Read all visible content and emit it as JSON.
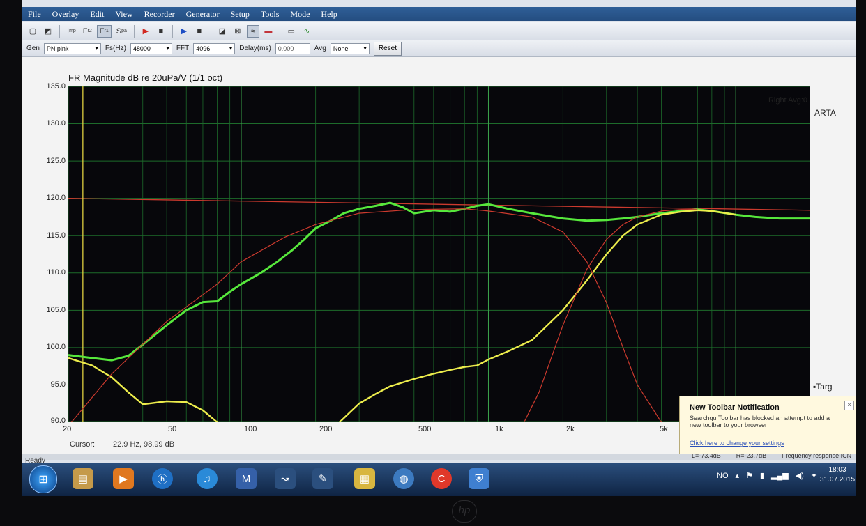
{
  "menu": [
    "File",
    "Overlay",
    "Edit",
    "View",
    "Recorder",
    "Generator",
    "Setup",
    "Tools",
    "Mode",
    "Help"
  ],
  "toolbar1": {
    "buttons": [
      "I",
      "F",
      "F",
      "S"
    ],
    "subs": [
      "mp",
      "r2",
      "r1",
      "pa"
    ]
  },
  "toolbar2": {
    "gen_label": "Gen",
    "gen_value": "PN pink",
    "fs_label": "Fs(Hz)",
    "fs_value": "48000",
    "fft_label": "FFT",
    "fft_value": "4096",
    "delay_label": "Delay(ms)",
    "delay_value": "0.000",
    "avg_label": "Avg",
    "avg_value": "None",
    "reset_label": "Reset"
  },
  "plot": {
    "title": "FR Magnitude dB re 20uPa/V (1/1 oct)",
    "status": "Right  Avg:0",
    "side_label": "ARTA",
    "target_label": "▪Targ",
    "cursor_label": "Cursor:",
    "cursor_value": "22.9 Hz, 98.99 dB",
    "y_ticks": [
      "135.0",
      "130.0",
      "125.0",
      "120.0",
      "115.0",
      "110.0",
      "105.0",
      "100.0",
      "95.0",
      "90.0"
    ],
    "x_ticks": [
      "20",
      "50",
      "100",
      "200",
      "500",
      "1k",
      "2k",
      "5k"
    ]
  },
  "chart_data": {
    "type": "line",
    "title": "FR Magnitude dB re 20uPa/V (1/1 oct)",
    "xlabel": "",
    "ylabel": "",
    "xscale": "log",
    "xlim": [
      20,
      20000
    ],
    "ylim": [
      90,
      135
    ],
    "grid": true,
    "cursor_x": 22.9,
    "colors": {
      "main": "#57e83c",
      "yellow": "#ecec4c",
      "target": "#cc3a2e",
      "cursor": "#e0d040",
      "grid": "#1d6b2b"
    },
    "series": [
      {
        "x": [
          20,
          25,
          30,
          35,
          40,
          50,
          60,
          70,
          80,
          90,
          100,
          120,
          140,
          160,
          180,
          200,
          230,
          260,
          300,
          350,
          400,
          450,
          500,
          600,
          700,
          800,
          900,
          1000,
          1200,
          1500,
          2000,
          2500,
          3000,
          3500,
          4000,
          5000,
          6000,
          7000,
          8000,
          10000,
          12000,
          15000,
          20000
        ],
        "y": [
          99.0,
          98.6,
          98.3,
          98.9,
          100.4,
          103.0,
          105.0,
          106.1,
          106.2,
          107.5,
          108.5,
          110.0,
          111.5,
          113.0,
          114.5,
          116.0,
          117.0,
          118.0,
          118.6,
          119.0,
          119.4,
          118.8,
          118.0,
          118.4,
          118.2,
          118.6,
          119.0,
          119.2,
          118.6,
          118.0,
          117.3,
          117.0,
          117.1,
          117.3,
          117.5,
          118.0,
          118.3,
          118.5,
          118.3,
          117.8,
          117.5,
          117.3,
          117.3
        ]
      },
      {
        "x": [
          20,
          25,
          30,
          35,
          40,
          50,
          60,
          70,
          80
        ],
        "y": [
          98.6,
          97.6,
          96.0,
          94.0,
          92.4,
          92.8,
          92.7,
          91.6,
          90.0
        ]
      },
      {
        "x": [
          250,
          300,
          350,
          400,
          500,
          600,
          700,
          800,
          900,
          1000,
          1200,
          1500,
          2000,
          2500,
          3000,
          3500,
          4000,
          5000,
          6000,
          7000,
          8000,
          10000
        ],
        "y": [
          90.0,
          92.5,
          93.8,
          94.8,
          95.8,
          96.5,
          97.0,
          97.4,
          97.6,
          98.4,
          99.5,
          101.0,
          105.0,
          109.0,
          112.5,
          115.0,
          116.5,
          117.8,
          118.2,
          118.4,
          118.3,
          117.8
        ]
      },
      {
        "x": [
          20,
          30,
          50,
          80,
          100,
          150,
          200,
          300,
          500,
          800,
          1000,
          1500,
          2000,
          2500,
          3000,
          3500,
          4000,
          5000,
          6000,
          7000
        ],
        "y": [
          89.5,
          96.5,
          103.5,
          108.5,
          111.5,
          114.8,
          116.5,
          118.0,
          118.5,
          118.6,
          118.3,
          117.5,
          115.5,
          111.5,
          106.0,
          100.0,
          95.0,
          90.0,
          86.0,
          83.0
        ]
      },
      {
        "x": [
          1000,
          1300,
          1600,
          2000,
          2500,
          3000,
          3500,
          4000,
          5000,
          6000,
          7000
        ],
        "y": [
          83.0,
          88.0,
          94.0,
          103.0,
          110.5,
          114.5,
          116.5,
          117.5,
          118.3,
          118.5,
          118.5
        ]
      }
    ],
    "target_level": 120.0,
    "target_level_end": 118.4
  },
  "notification": {
    "title": "New Toolbar Notification",
    "body": "Searchqu Toolbar has blocked an attempt to add a new toolbar to your browser",
    "link": "Click here to change your settings"
  },
  "statusbar": {
    "ready": "Ready",
    "readouts": [
      "L=-73.4dB",
      "R=-23.7dB",
      "Frequency response ICN"
    ]
  },
  "taskbar": {
    "tray_lang": "NO",
    "clock_time": "18:03",
    "clock_date": "31.07.2015",
    "bezel_logo": "hp"
  }
}
